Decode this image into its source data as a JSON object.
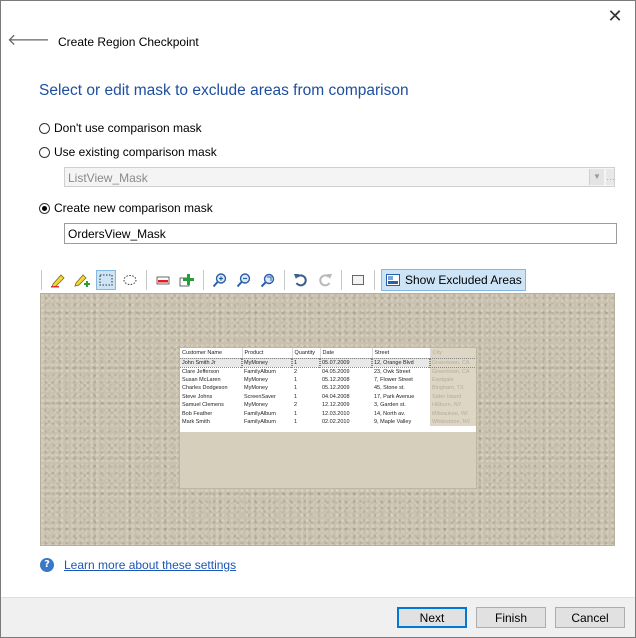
{
  "window": {
    "title": "Create Region Checkpoint",
    "close_glyph": "✕",
    "back_glyph": "🡐"
  },
  "heading": "Select or edit mask to exclude areas from comparison",
  "options": {
    "no_mask": "Don't use comparison mask",
    "use_existing": "Use existing comparison mask",
    "create_new": "Create new comparison mask",
    "selected": "create_new"
  },
  "existing_mask": {
    "value": "ListView_Mask"
  },
  "new_mask": {
    "value": "OrdersView_Mask"
  },
  "toolbar": {
    "icons": [
      "add-mask-pencil-icon",
      "remove-mask-pencil-icon",
      "rect-select-icon",
      "ellipse-select-icon",
      "remove-area-icon",
      "add-area-icon",
      "zoom-in-icon",
      "zoom-out-icon",
      "zoom-fit-icon",
      "undo-icon",
      "redo-icon",
      "clear-icon",
      "show-excluded-icon"
    ],
    "show_excluded_label": "Show Excluded Areas",
    "colors": {
      "active_bg": "#cde4f7",
      "active_border": "#86b7e1"
    }
  },
  "grid": {
    "columns": [
      "Customer Name",
      "Product",
      "Quantity",
      "Date",
      "Street",
      "City"
    ],
    "rows": [
      [
        "John Smith Jr",
        "MyMoney",
        "1",
        "05.07.2009",
        "12, Orange Blvd",
        "Greentown, CA"
      ],
      [
        "Clare Jefferson",
        "FamilyAlbum",
        "2",
        "04.05.2009",
        "23, Owk Street",
        "Greentown, CA"
      ],
      [
        "Susan McLaren",
        "MyMoney",
        "1",
        "05.12.2008",
        "7, Flower Street",
        "Eastgate"
      ],
      [
        "Charles Dodgeson",
        "MyMoney",
        "1",
        "05.12.2009",
        "45, Stone st.",
        "Bingham, TX"
      ],
      [
        "Steve Johns",
        "ScreenSaver",
        "1",
        "04.04.2008",
        "17, Park Avenue",
        "Safer Island"
      ],
      [
        "Samuel Clemens",
        "MyMoney",
        "2",
        "12.12.2009",
        "3, Garden st.",
        "Hillburn, NY"
      ],
      [
        "Bob Feather",
        "FamilyAlbum",
        "1",
        "12.03.2010",
        "14, North av.",
        "Milwaukee, WI"
      ],
      [
        "Mark Smith",
        "FamilyAlbum",
        "1",
        "02.02.2010",
        "9, Maple Valley",
        "Whitestone, NV"
      ]
    ]
  },
  "help": {
    "icon_glyph": "?",
    "link": "Learn more about these settings"
  },
  "buttons": {
    "next": "Next",
    "finish": "Finish",
    "cancel": "Cancel"
  },
  "colors": {
    "heading": "#1e4e9e",
    "link": "#1b56b8",
    "texture": "#c9c1ad"
  }
}
